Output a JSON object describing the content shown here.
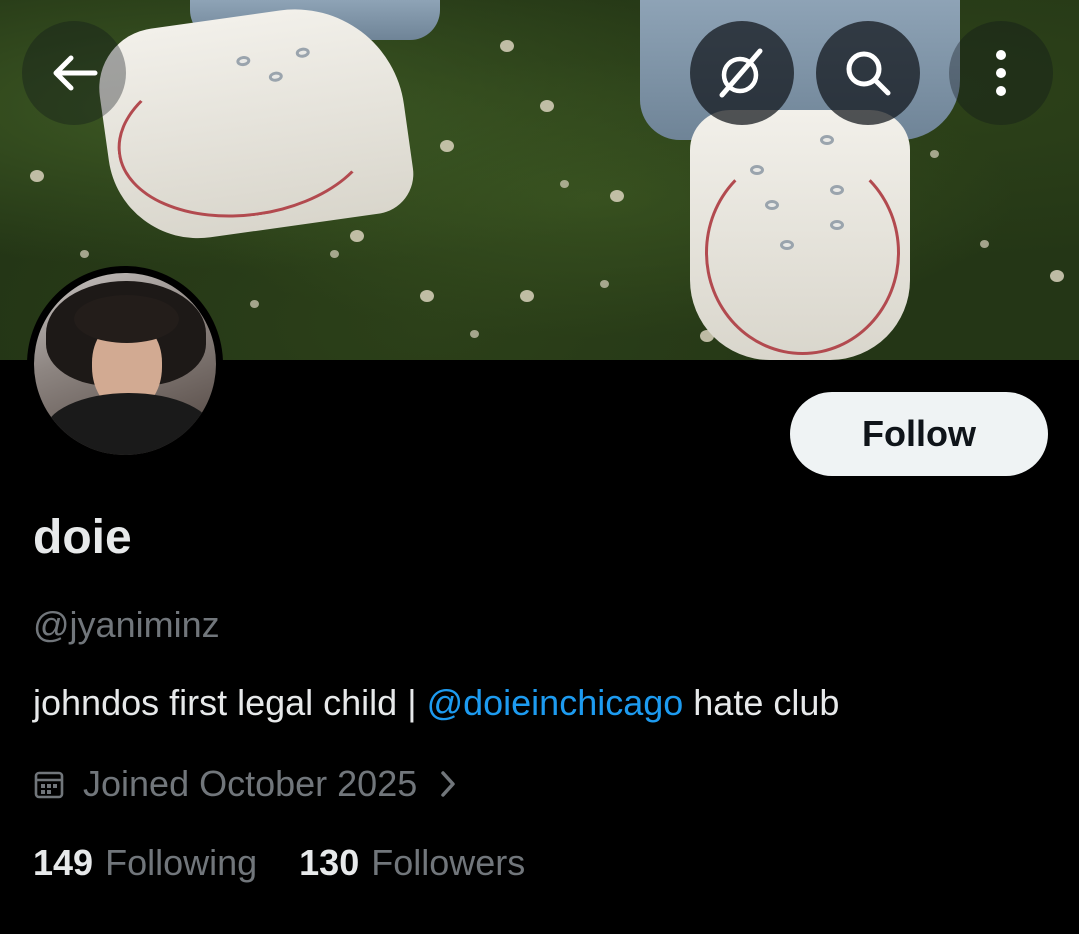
{
  "header": {
    "back_icon": "arrow-left-icon",
    "grok_icon": "grok-slash-icon",
    "search_icon": "search-icon",
    "more_icon": "more-vertical-icon"
  },
  "profile": {
    "display_name": "doie",
    "handle": "@jyaniminz",
    "bio_prefix": "johndos first legal child | ",
    "bio_mention": "@doieinchicago",
    "bio_suffix": " hate club",
    "joined": "Joined October 2025",
    "following_count": "149",
    "following_label": "Following",
    "followers_count": "130",
    "followers_label": "Followers"
  },
  "actions": {
    "follow_label": "Follow"
  },
  "colors": {
    "background": "#000000",
    "primary_text": "#e7e9ea",
    "secondary_text": "#71767b",
    "mention": "#1d9bf0",
    "follow_button_bg": "#eff3f4"
  }
}
